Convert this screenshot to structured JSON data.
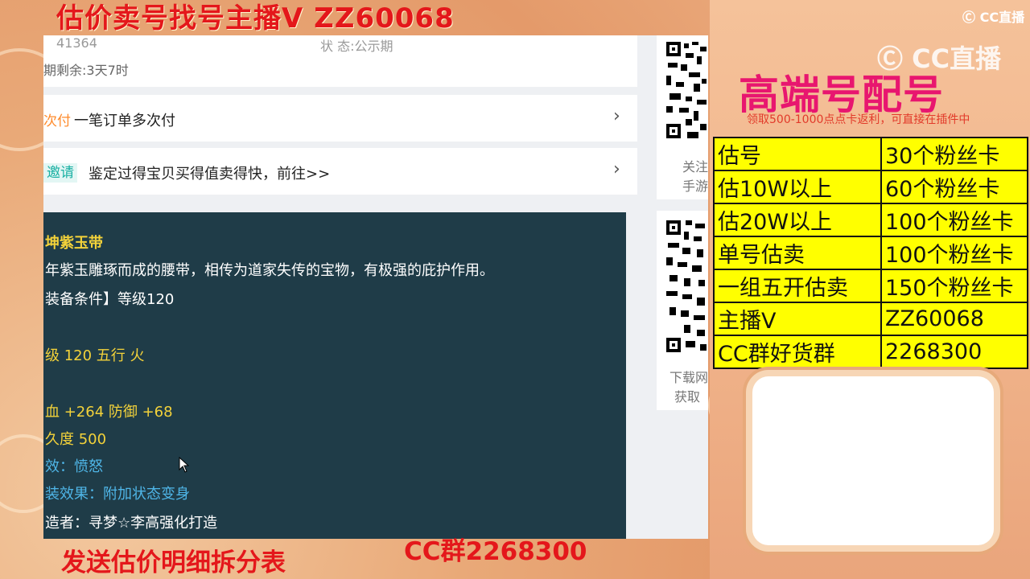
{
  "banner": {
    "top_title": "估价卖号找号主播V ZZ60068",
    "bottom_left": "发送估价明细拆分表",
    "bottom_mid": "CC群2268300"
  },
  "window": {
    "info": {
      "id_partial": "41364",
      "status_partial": "状 态:公示期",
      "remaining": "期剩余:3天7时"
    },
    "row1": {
      "tag": "次付",
      "text": "一笔订单多次付"
    },
    "row2": {
      "tag": "邀请",
      "text": "鉴定过得宝贝买得值卖得快，前往>>"
    },
    "tooltip": {
      "name": "坤紫玉带",
      "desc": "年紫玉雕琢而成的腰带，相传为道家失传的宝物，有极强的庇护作用。",
      "req": "装备条件】等级120",
      "level": "级 120 五行 火",
      "stats": "血 +264 防御 +68",
      "durability": "久度 500",
      "effect": "效：愤怒",
      "set_effect": "装效果：附加状态变身",
      "maker": "造者：寻梦☆李高强化打造"
    },
    "side": {
      "qr1_text_a": "关注",
      "qr1_text_b": "手游",
      "qr2_text_a": "下载网",
      "qr2_text_b": "获取"
    }
  },
  "overlay": {
    "cc_logo_small": "CC直播",
    "cc_logo_large": "CC直播",
    "pink_title": "高端号配号",
    "promo": "领取500-1000点点卡返利，可直接在插件中",
    "price_table": [
      [
        "估号",
        "30个粉丝卡"
      ],
      [
        "估10W以上",
        "60个粉丝卡"
      ],
      [
        "估20W以上",
        "100个粉丝卡"
      ],
      [
        "单号估卖",
        "100个粉丝卡"
      ],
      [
        "一组五开估卖",
        "150个粉丝卡"
      ],
      [
        "主播V",
        "ZZ60068"
      ],
      [
        "CC群好货群",
        "2268300"
      ]
    ]
  }
}
